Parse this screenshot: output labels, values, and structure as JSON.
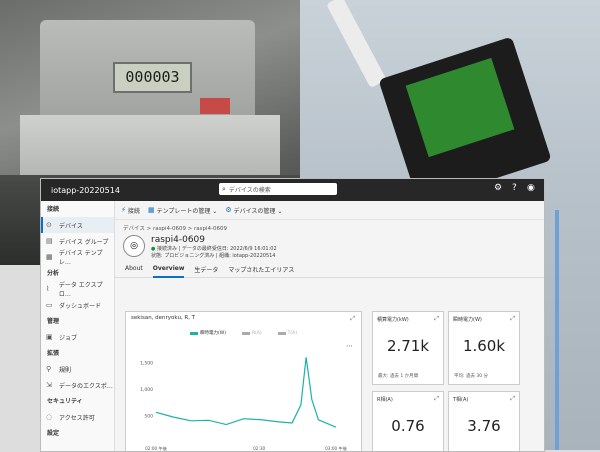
{
  "meter": {
    "lcd": "000003"
  },
  "app": {
    "title": "iotapp-20220514",
    "search_placeholder": "デバイスの検索"
  },
  "sidebar": {
    "sections": [
      {
        "label": "接続",
        "items": [
          {
            "label": "デバイス",
            "icon": "device-icon",
            "active": true
          },
          {
            "label": "デバイス グループ",
            "icon": "group-icon"
          },
          {
            "label": "デバイス テンプレ…",
            "icon": "template-icon"
          }
        ]
      },
      {
        "label": "分析",
        "items": [
          {
            "label": "データ エクスプロ…",
            "icon": "chart-icon"
          },
          {
            "label": "ダッシュボード",
            "icon": "dashboard-icon"
          }
        ]
      },
      {
        "label": "管理",
        "items": [
          {
            "label": "ジョブ",
            "icon": "job-icon"
          }
        ]
      },
      {
        "label": "拡張",
        "items": [
          {
            "label": "規則",
            "icon": "rules-icon"
          },
          {
            "label": "データのエクスポ…",
            "icon": "export-icon"
          }
        ]
      },
      {
        "label": "セキュリティ",
        "items": [
          {
            "label": "アクセス許可",
            "icon": "permission-icon"
          }
        ]
      },
      {
        "label": "設定",
        "items": []
      }
    ]
  },
  "commands": [
    {
      "label": "接続",
      "icon": "plug-icon"
    },
    {
      "label": "テンプレートの管理",
      "icon": "template-icon"
    },
    {
      "label": "デバイスの管理",
      "icon": "gear-icon"
    }
  ],
  "breadcrumb": "デバイス > raspi4-0609 > raspi4-0609",
  "device": {
    "name": "raspi4-0609",
    "line1_status": "接続済み",
    "line1_rest": "| データの最終受信日: 2022/6/9 16:01:02",
    "line2": "状態: プロビジョニング済み | 組織: iotapp-20220514"
  },
  "tabs": [
    "About",
    "Overview",
    "生データ",
    "マップされたエイリアス"
  ],
  "active_tab": "Overview",
  "chart_card": {
    "title": "sekisan, denryoku, R, T",
    "legend": [
      {
        "name": "瞬時電力(W)",
        "color": "#1ab3a6"
      },
      {
        "name": "R(A)",
        "color": "#aaaaaa"
      },
      {
        "name": "T(A)",
        "color": "#aaaaaa"
      }
    ]
  },
  "chart_data": {
    "type": "line",
    "series": [
      {
        "name": "瞬時電力(W)",
        "values": [
          {
            "x": 0,
            "y": 560
          },
          {
            "x": 4,
            "y": 470
          },
          {
            "x": 8,
            "y": 400
          },
          {
            "x": 12,
            "y": 410
          },
          {
            "x": 16,
            "y": 330
          },
          {
            "x": 20,
            "y": 440
          },
          {
            "x": 24,
            "y": 420
          },
          {
            "x": 28,
            "y": 380
          },
          {
            "x": 31,
            "y": 360
          },
          {
            "x": 33,
            "y": 700
          },
          {
            "x": 34.2,
            "y": 1600
          },
          {
            "x": 35.5,
            "y": 800
          },
          {
            "x": 37,
            "y": 420
          },
          {
            "x": 41,
            "y": 280
          }
        ]
      }
    ],
    "yticks": [
      "1,500",
      "1,000",
      "500"
    ],
    "ylim": [
      0,
      1700
    ],
    "xticks": [
      {
        "l1": "02:00 午後",
        "l2": "2022/06/09"
      },
      {
        "l1": "02:30",
        "l2": "午後"
      },
      {
        "l1": "03:00 午後",
        "l2": "2022/06/09"
      }
    ]
  },
  "tiles": [
    {
      "label": "積算電力(kW)",
      "value": "2.71k",
      "sub": "最大: 過去 1 か月間"
    },
    {
      "label": "瞬時電力(W)",
      "value": "1.60k",
      "sub": "平均: 過去 30 分"
    },
    {
      "label": "R相(A)",
      "value": "0.76",
      "sub": "平均: 過去 30 分"
    },
    {
      "label": "T相(A)",
      "value": "3.76",
      "sub": "平均: 過去 30 分"
    }
  ]
}
